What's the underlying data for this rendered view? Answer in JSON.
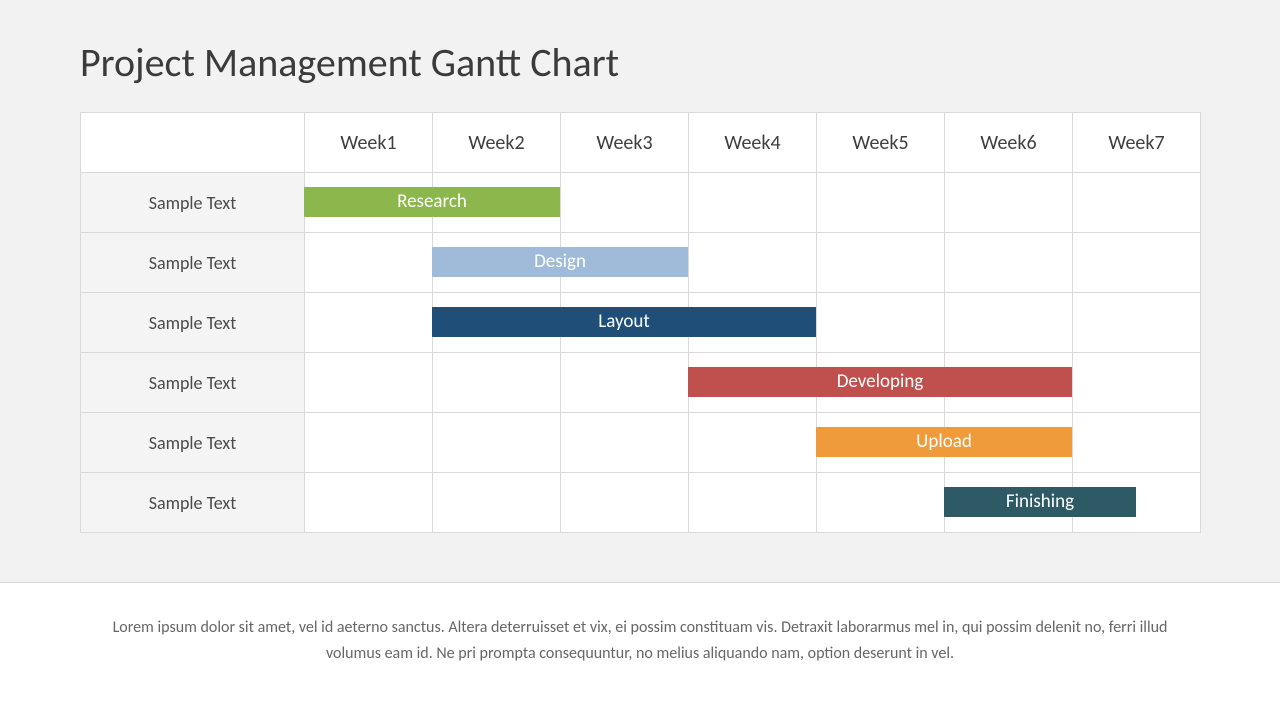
{
  "title": "Project Management Gantt Chart",
  "columns": [
    "Week1",
    "Week2",
    "Week3",
    "Week4",
    "Week5",
    "Week6",
    "Week7"
  ],
  "row_labels": [
    "Sample Text",
    "Sample Text",
    "Sample Text",
    "Sample Text",
    "Sample Text",
    "Sample Text"
  ],
  "chart_data": {
    "type": "bar",
    "title": "Project Management Gantt Chart",
    "categories": [
      "Week1",
      "Week2",
      "Week3",
      "Week4",
      "Week5",
      "Week6",
      "Week7"
    ],
    "series": [
      {
        "name": "Research",
        "row": 0,
        "start": 1,
        "end": 3,
        "start_half": false,
        "end_half": false,
        "color": "#8cb74d"
      },
      {
        "name": "Design",
        "row": 1,
        "start": 2,
        "end": 4,
        "start_half": false,
        "end_half": false,
        "color": "#9fbbd9"
      },
      {
        "name": "Layout",
        "row": 2,
        "start": 2,
        "end": 5,
        "start_half": false,
        "end_half": false,
        "color": "#1f4e79"
      },
      {
        "name": "Developing",
        "row": 3,
        "start": 4,
        "end": 7,
        "start_half": false,
        "end_half": false,
        "color": "#c0504d"
      },
      {
        "name": "Upload",
        "row": 4,
        "start": 5,
        "end": 7,
        "start_half": false,
        "end_half": false,
        "color": "#ef9a3b"
      },
      {
        "name": "Finishing",
        "row": 5,
        "start": 6,
        "end": 8,
        "start_half": false,
        "end_half": true,
        "color": "#2e5a66"
      }
    ]
  },
  "footer": "Lorem ipsum dolor sit amet, vel id aeterno sanctus. Altera deterruisset et vix, ei possim constituam vis. Detraxit laborarmus mel in, qui possim delenit no, ferri illud volumus eam id. Ne pri prompta consequuntur, no melius aliquando nam, option deserunt in vel."
}
